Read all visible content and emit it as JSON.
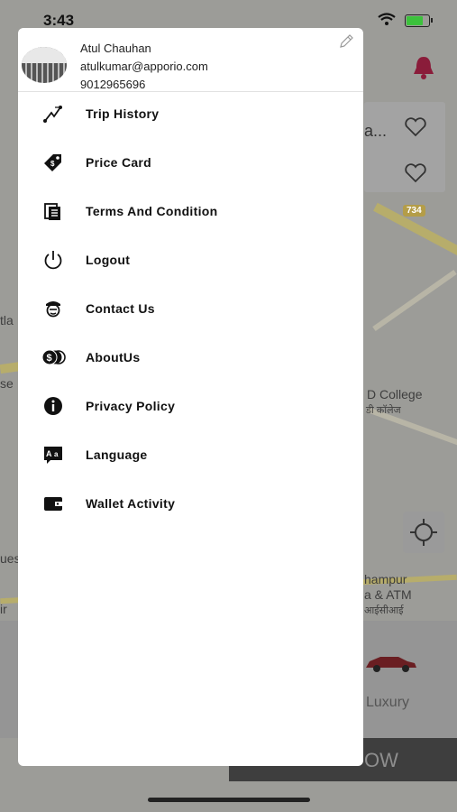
{
  "status_bar": {
    "time": "3:43"
  },
  "profile": {
    "name": "Atul Chauhan",
    "email": "atulkumar@apporio.com",
    "phone": "9012965696"
  },
  "menu": [
    {
      "label": "Trip History",
      "icon": "route-icon"
    },
    {
      "label": "Price Card",
      "icon": "price-tag-icon"
    },
    {
      "label": "Terms And Condition",
      "icon": "documents-icon"
    },
    {
      "label": "Logout",
      "icon": "power-icon"
    },
    {
      "label": "Contact Us",
      "icon": "support-agent-icon"
    },
    {
      "label": "AboutUs",
      "icon": "coins-icon"
    },
    {
      "label": "Privacy Policy",
      "icon": "info-icon"
    },
    {
      "label": "Language",
      "icon": "translate-icon"
    },
    {
      "label": "Wallet Activity",
      "icon": "wallet-icon"
    }
  ],
  "background": {
    "map_labels": {
      "college": "D College",
      "college_hi": "डी कॉलेज",
      "road_number": "734",
      "atm_line1": "hampur",
      "atm_line2": "a & ATM",
      "atm_hi": "आईसीआई",
      "left1": "tla",
      "left2": "se",
      "left3": "ues",
      "left4": "ir"
    },
    "search_snippet": "a...",
    "vehicle_label": "Luxury",
    "action_button": "OW"
  },
  "colors": {
    "drawer_bg": "#ffffff",
    "map_overlay": "#9c9c98",
    "bell": "#8a1c3a",
    "battery": "#3cc23c"
  }
}
